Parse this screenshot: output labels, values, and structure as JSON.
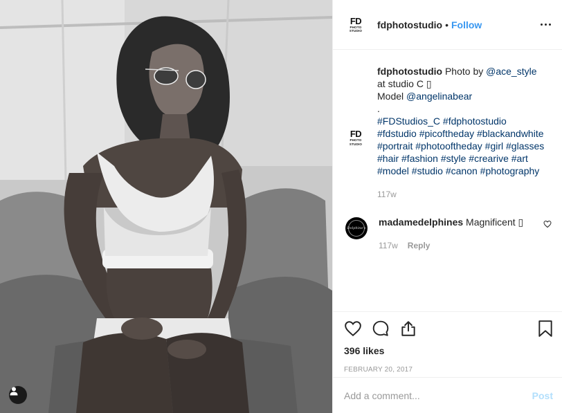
{
  "post": {
    "image_alt": "Black and white portrait of a woman in sunglasses and a white sports top seated in an armchair",
    "user_tag_icon": "person-icon"
  },
  "header": {
    "logo_text": "FD",
    "logo_sub": "PHOTO",
    "logo_sub2": "STUDIO",
    "username": "fdphotostudio",
    "dot": "•",
    "follow_label": "Follow",
    "more_icon": "more-options-icon"
  },
  "caption": {
    "username": "fdphotostudio",
    "parts": [
      {
        "text": " Photo by ",
        "type": "plain"
      },
      {
        "text": "@ace_style",
        "type": "tag"
      },
      {
        "text": " at studio C ▯",
        "type": "plain"
      },
      {
        "text": "\nModel ",
        "type": "plain"
      },
      {
        "text": "@angelinabear",
        "type": "tag"
      },
      {
        "text": "\n.\n",
        "type": "plain"
      },
      {
        "text": "#FDStudios_C #fdphotostudio #fdstudio #picoftheday #blackandwhite #portrait #photooftheday #girl #glasses #hair #fashion #style #crearive #art #model #studio #canon #photography",
        "type": "tag"
      }
    ],
    "time": "117w"
  },
  "comment": {
    "avatar_text": "Dolphine's",
    "username": "madamedelphines",
    "text": " Magnificent ▯",
    "time": "117w",
    "reply_label": "Reply"
  },
  "actions": {
    "likes": "396 likes",
    "date": "FEBRUARY 20, 2017"
  },
  "add_comment": {
    "placeholder": "Add a comment...",
    "post_label": "Post"
  },
  "colors": {
    "link": "#3897f0",
    "tag": "#003569",
    "muted": "#999999",
    "post_disabled": "#b2dffc"
  }
}
